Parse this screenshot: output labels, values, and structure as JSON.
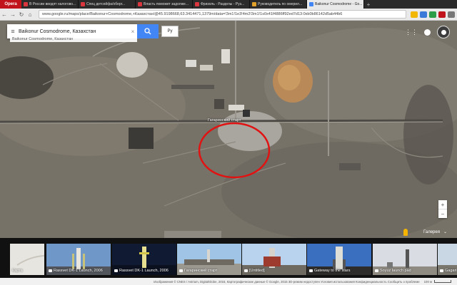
{
  "browser": {
    "opera_label": "Opera",
    "tabs": [
      {
        "label": "В России вводят налогово...",
        "color": "#d9363e"
      },
      {
        "label": "Спец детсейфа/оберг...",
        "color": "#d9363e"
      },
      {
        "label": "Власть поможет задолже...",
        "color": "#d9363e"
      },
      {
        "label": "Фризоль - Разделы - Руз...",
        "color": "#d9363e"
      },
      {
        "label": "Руководитель по омерил...",
        "color": "#e0a02c"
      },
      {
        "label": "Baikonur Cosmodrome - Go...",
        "color": "#4285f4",
        "active": true
      }
    ],
    "new_tab": "+",
    "url": "www.google.ru/maps/place/Baikonur+Cosmodrome,+Казахстан/@45.9198668,63.3414471,1379m/data=!3m1!1e3!4m2!3m1!1s0x41f4886ff92ed7d13:0xb0b86142d5ab44b6"
  },
  "search": {
    "query": "Baikonur Cosmodrome, Казахстан",
    "suggestion": "Baikonur Cosmodrome, Казахстан",
    "language": "Ру"
  },
  "map": {
    "marker_label": "Гагаринский старт",
    "annotation_color": "#e11212"
  },
  "gallery": {
    "header": "Галерея",
    "thumbs": [
      {
        "caption": "Карта",
        "type": "map",
        "has_cam": false
      },
      {
        "caption": "Rassvet DK-1 Launch, 2006",
        "type": "rocket",
        "has_cam": true
      },
      {
        "caption": "Rassvet DK-1 Launch, 2006",
        "type": "rocket-night",
        "has_cam": true
      },
      {
        "caption": "Гагаринский старт",
        "type": "pad",
        "has_cam": true
      },
      {
        "caption": "[Untitled]",
        "type": "pad2",
        "has_cam": true
      },
      {
        "caption": "Gateway to the stars",
        "type": "rocket2",
        "has_cam": true
      },
      {
        "caption": "Soyuz launch pad",
        "type": "pad3",
        "has_cam": true
      },
      {
        "caption": "Gagari...",
        "type": "rocket3",
        "has_cam": true
      }
    ]
  },
  "footer": {
    "text": "Изображения © CNES / Astrium, DigitalGlobe, 2015, Картографические данные © Google, 2015    3D-режим недоступен    Условия использования    Конфиденциальность    Сообщить о проблеме",
    "scale": "100 м"
  }
}
